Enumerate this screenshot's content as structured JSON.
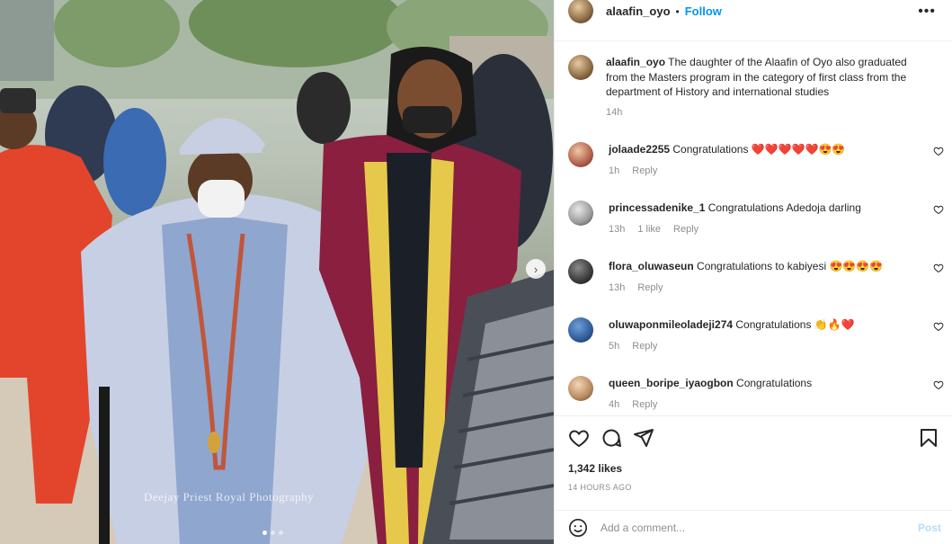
{
  "post": {
    "username": "alaafin_oyo",
    "follow_label": "Follow",
    "more_label": "•••",
    "watermark": "Deejay Priest Royal Photography"
  },
  "caption": {
    "username": "alaafin_oyo",
    "text": "The daughter of the Alaafin of Oyo also graduated from the Masters program in the category of first class from the department of History and international studies",
    "time": "14h"
  },
  "comments": [
    {
      "username": "jolaade2255",
      "text": "Congratulations ❤️❤️❤️❤️❤️😍😍",
      "time": "1h",
      "likes": "",
      "reply": "Reply"
    },
    {
      "username": "princessadenike_1",
      "text": "Congratulations Adedoja darling",
      "time": "13h",
      "likes": "1 like",
      "reply": "Reply"
    },
    {
      "username": "flora_oluwaseun",
      "text": "Congratulations to kabiyesi 😍😍😍😍",
      "time": "13h",
      "likes": "",
      "reply": "Reply"
    },
    {
      "username": "oluwaponmileoladeji274",
      "text": "Congratulations 👏🔥❤️",
      "time": "5h",
      "likes": "",
      "reply": "Reply"
    },
    {
      "username": "queen_boripe_iyaogbon",
      "text": "Congratulations",
      "time": "4h",
      "likes": "",
      "reply": "Reply"
    }
  ],
  "stats": {
    "likes": "1,342 likes",
    "time_ago": "14 HOURS AGO"
  },
  "composer": {
    "placeholder": "Add a comment...",
    "post_label": "Post"
  },
  "colors": {
    "accent": "#0095f6",
    "text": "#262626",
    "muted": "#8e8e8e",
    "post_disabled": "#b2dffc"
  },
  "icons": {
    "like": "heart-icon",
    "comment": "comment-icon",
    "share": "share-icon",
    "save": "bookmark-icon",
    "emoji": "smile-icon",
    "options": "more-icon",
    "next": "chevron-right-icon"
  }
}
